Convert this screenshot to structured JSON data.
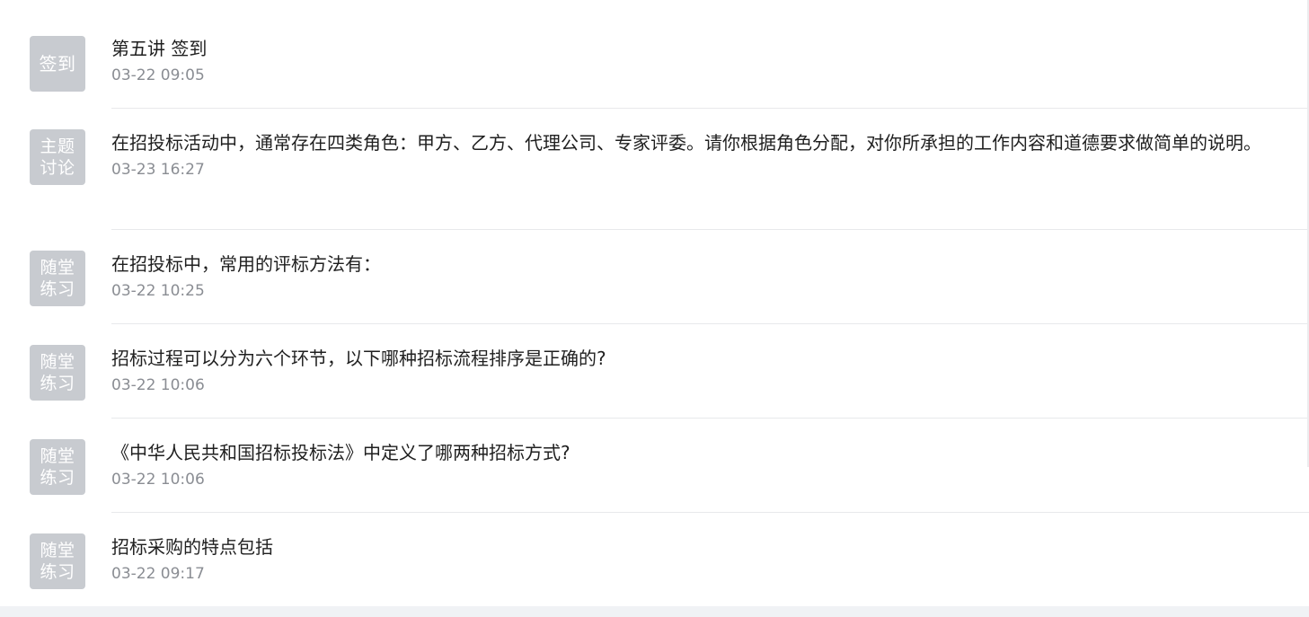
{
  "activities": [
    {
      "badge": "签到",
      "title": "第五讲 签到",
      "time": "03-22 09:05"
    },
    {
      "badge": "主题\n讨论",
      "title": "在招投标活动中，通常存在四类角色：甲方、乙方、代理公司、专家评委。请你根据角色分配，对你所承担的工作内容和道德要求做简单的说明。",
      "time": "03-23 16:27"
    },
    {
      "badge": "随堂\n练习",
      "title": "在招投标中，常用的评标方法有：",
      "time": "03-22 10:25"
    },
    {
      "badge": "随堂\n练习",
      "title": "招标过程可以分为六个环节，以下哪种招标流程排序是正确的?",
      "time": "03-22 10:06"
    },
    {
      "badge": "随堂\n练习",
      "title": "《中华人民共和国招标投标法》中定义了哪两种招标方式?",
      "time": "03-22 10:06"
    },
    {
      "badge": "随堂\n练习",
      "title": "招标采购的特点包括",
      "time": "03-22 09:17"
    }
  ],
  "colors": {
    "badge_bg": "#c8cbd0",
    "title_text": "#1f1f1f",
    "time_text": "#8a8d93",
    "divider": "#e8e9eb"
  }
}
